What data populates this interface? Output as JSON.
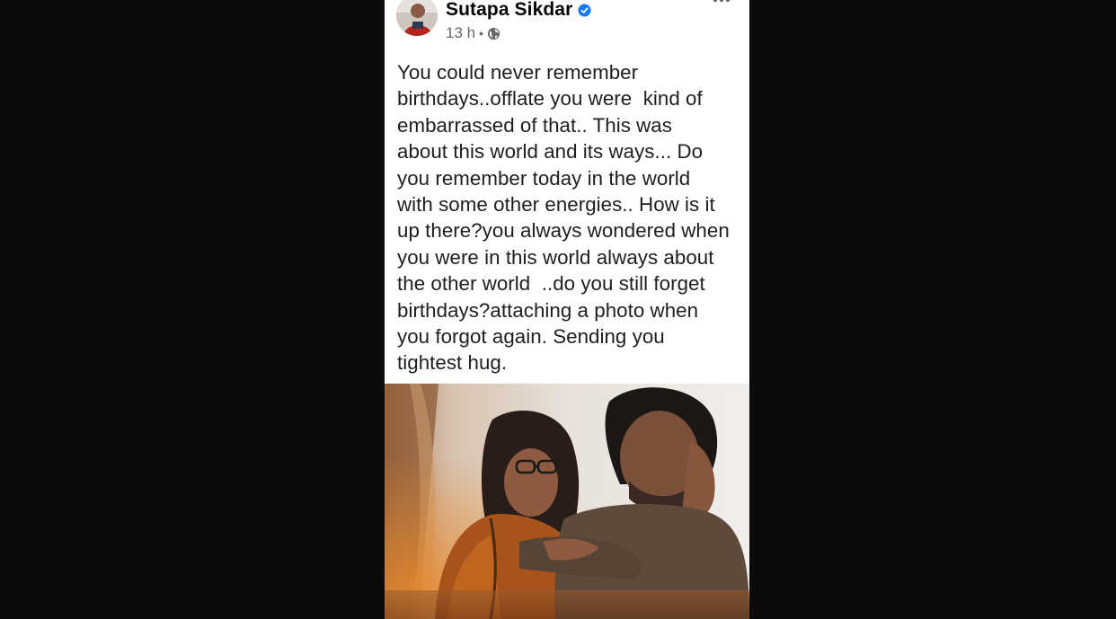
{
  "post": {
    "author": {
      "name": "Sutapa Sikdar",
      "verified": true,
      "avatar_icon": "profile-avatar"
    },
    "meta": {
      "timestamp": "13 h",
      "separator": "•",
      "privacy_icon": "globe-icon"
    },
    "menu_icon": "more-options-icon",
    "text": "You could never remember\nbirthdays..offlate you were  kind of\nembarrassed of that.. This was\nabout this world and its ways... Do\nyou remember today in the world\nwith some other energies.. How is it\nup there?you always wondered when\nyou were in this world always about\nthe other world  ..do you still forget\nbirthdays?attaching a photo when\nyou forgot again. Sending you\ntightest hug.",
    "photo_icon": "attached-photo"
  },
  "colors": {
    "page_background": "#0b0b0b",
    "card_background": "#ffffff",
    "name_text": "#050505",
    "body_text": "#1c1e21",
    "meta_text": "#65676b",
    "verified_blue": "#1877f2"
  }
}
